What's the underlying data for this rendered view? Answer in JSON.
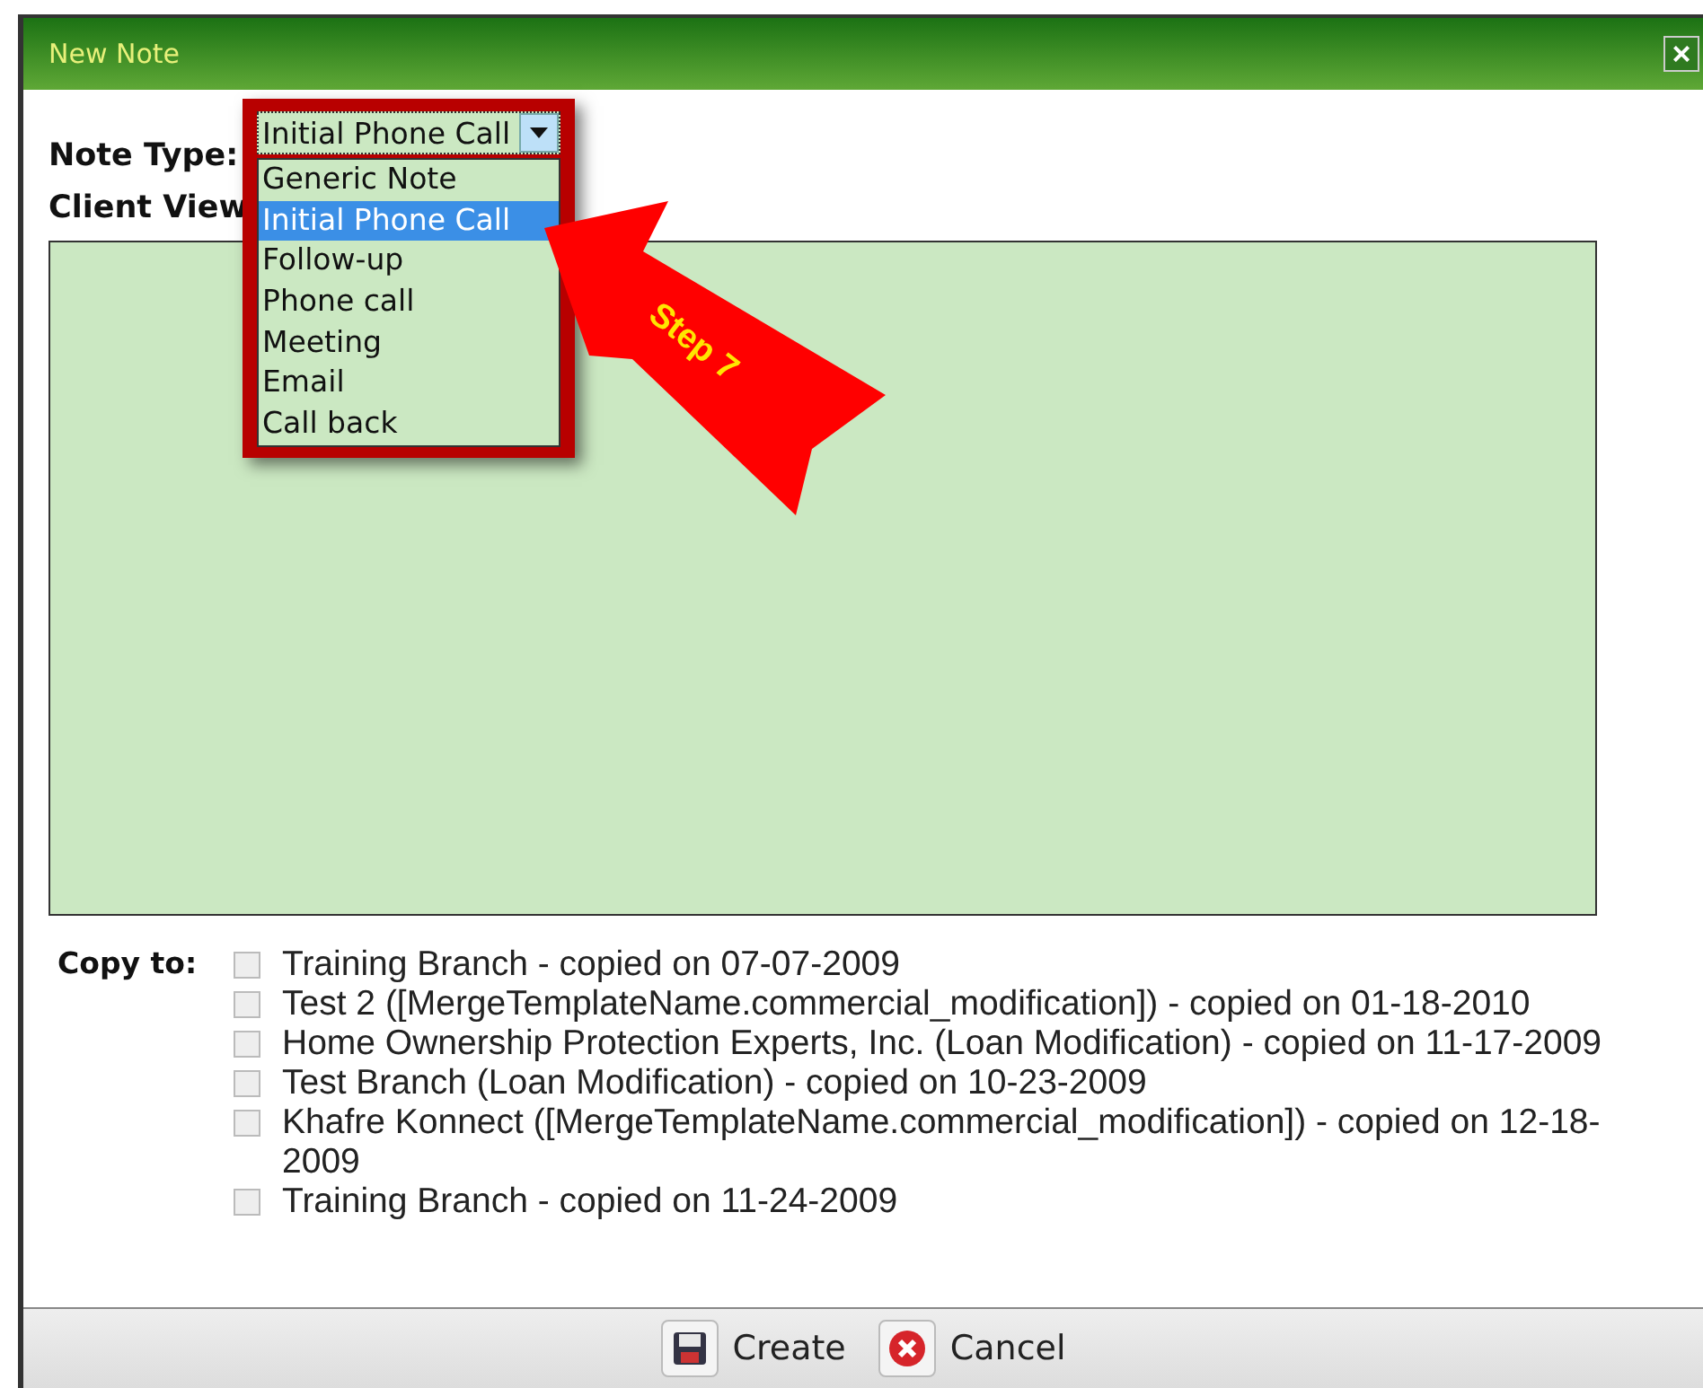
{
  "window": {
    "title": "New Note",
    "close": "×"
  },
  "note_type": {
    "label": "Note Type:",
    "value": "Initial Phone Call",
    "expanded": true,
    "options": [
      {
        "label": "Generic Note",
        "selected": false
      },
      {
        "label": "Initial Phone Call",
        "selected": true
      },
      {
        "label": "Follow-up",
        "selected": false
      },
      {
        "label": "Phone call",
        "selected": false
      },
      {
        "label": "Meeting",
        "selected": false
      },
      {
        "label": "Email",
        "selected": false
      },
      {
        "label": "Call back",
        "selected": false
      }
    ]
  },
  "client_view": {
    "label": "Client View"
  },
  "callout": {
    "text": "Step 7"
  },
  "copy_to": {
    "label": "Copy to:",
    "items": [
      {
        "label": "Training Branch - copied on 07-07-2009",
        "checked": false
      },
      {
        "label": "Test 2 ([MergeTemplateName.commercial_modification]) - copied on 01-18-2010",
        "checked": false
      },
      {
        "label": "Home Ownership Protection Experts, Inc. (Loan Modification) - copied on 11-17-2009",
        "checked": false
      },
      {
        "label": "Test Branch (Loan Modification) - copied on 10-23-2009",
        "checked": false
      },
      {
        "label": "Khafre Konnect ([MergeTemplateName.commercial_modification]) - copied on 12-18-2009",
        "checked": false
      },
      {
        "label": "Training Branch - copied on 11-24-2009",
        "checked": false
      }
    ]
  },
  "buttons": [
    {
      "kind": "save",
      "label": "Create"
    },
    {
      "kind": "cancel",
      "label": "Cancel"
    }
  ]
}
